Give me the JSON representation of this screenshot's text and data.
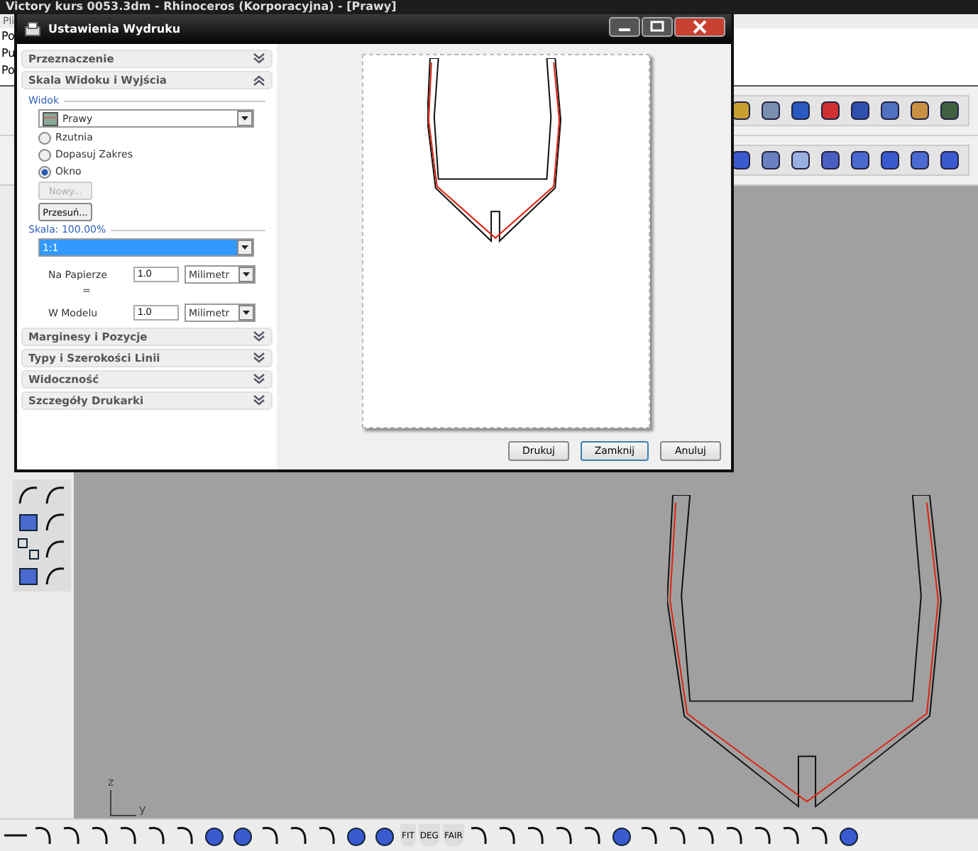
{
  "app": {
    "title": "Victory kurs 0053.3dm - Rhinoceros (Korporacyjna) - [Prawy]",
    "menu": [
      "Pli"
    ],
    "command_lines": [
      "Po",
      "Pu",
      "Po"
    ]
  },
  "dialog": {
    "title": "Ustawienia Wydruku",
    "sections": [
      {
        "title": "Przeznaczenie",
        "expanded": false
      },
      {
        "title": "Skala Widoku i Wyjścia",
        "expanded": true
      },
      {
        "title": "Marginesy i Pozycje",
        "expanded": false
      },
      {
        "title": "Typy i Szerokości Linii",
        "expanded": false
      },
      {
        "title": "Widoczność",
        "expanded": false
      },
      {
        "title": "Szczegóły Drukarki",
        "expanded": false
      }
    ],
    "view": {
      "label": "Widok",
      "value": "Prawy",
      "options": [
        {
          "label": "Rzutnia",
          "selected": false
        },
        {
          "label": "Dopasuj Zakres",
          "selected": false
        },
        {
          "label": "Okno",
          "selected": true
        }
      ]
    },
    "window_buttons": [
      {
        "label": "Nowy...",
        "disabled": true
      },
      {
        "label": "Przesuń...",
        "disabled": false
      }
    ],
    "scale": {
      "label": "Skala: 100.00%",
      "value": "1:1",
      "equals": "=",
      "rows": [
        {
          "label": "Na Papierze",
          "value": "1.0",
          "unit": "Milimetr"
        },
        {
          "label": "W Modelu",
          "value": "1.0",
          "unit": "Milimetr"
        }
      ]
    },
    "buttons": [
      {
        "label": "Drukuj",
        "default": false
      },
      {
        "label": "Zamknij",
        "default": true
      },
      {
        "label": "Anuluj",
        "default": false
      }
    ]
  },
  "viewport": {
    "axis_labels": [
      "z",
      "y"
    ]
  },
  "bottom_toolbar": [
    {
      "kind": "line"
    },
    {
      "kind": "curve"
    },
    {
      "kind": "curve"
    },
    {
      "kind": "curve"
    },
    {
      "kind": "curve"
    },
    {
      "kind": "curve"
    },
    {
      "kind": "curve"
    },
    {
      "kind": "blob"
    },
    {
      "kind": "blob"
    },
    {
      "kind": "curve"
    },
    {
      "kind": "curve"
    },
    {
      "kind": "curve"
    },
    {
      "kind": "blob"
    },
    {
      "kind": "blob"
    },
    {
      "kind": "text",
      "label": "FIT"
    },
    {
      "kind": "text",
      "label": "DEG"
    },
    {
      "kind": "text",
      "label": "FAIR"
    },
    {
      "kind": "curve"
    },
    {
      "kind": "curve"
    },
    {
      "kind": "curve"
    },
    {
      "kind": "curve"
    },
    {
      "kind": "curve"
    },
    {
      "kind": "blob"
    },
    {
      "kind": "curve"
    },
    {
      "kind": "curve"
    },
    {
      "kind": "curve"
    },
    {
      "kind": "curve"
    },
    {
      "kind": "curve"
    },
    {
      "kind": "curve"
    },
    {
      "kind": "curve"
    },
    {
      "kind": "blob"
    }
  ]
}
